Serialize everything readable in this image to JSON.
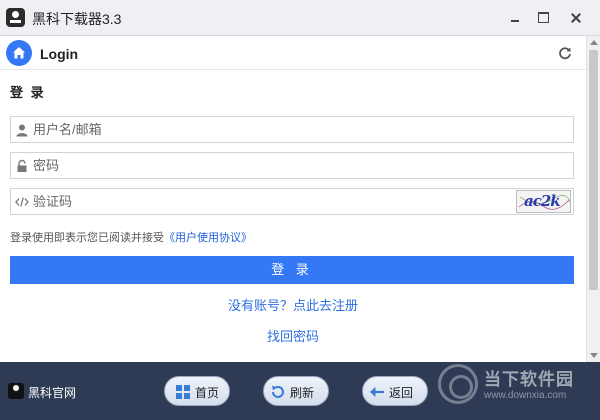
{
  "window": {
    "title": "黑科下载器3.3"
  },
  "header": {
    "title": "Login"
  },
  "form": {
    "section_title": "登 录",
    "username_placeholder": "用户名/邮箱",
    "password_placeholder": "密码",
    "captcha_placeholder": "验证码",
    "captcha_text": "ac2k",
    "agreement_prefix": "登录使用即表示您已阅读并接受",
    "agreement_link": "《用户使用协议》",
    "login_label": "登 录",
    "register_label": "没有账号？点此去注册",
    "recover_label": "找回密码"
  },
  "footer": {
    "site_label": "黑科官网",
    "home_label": "首页",
    "refresh_label": "刷新",
    "back_label": "返回"
  },
  "watermark": {
    "text": "当下软件园",
    "url": "www.downxia.com"
  },
  "colors": {
    "accent": "#3478f6",
    "link": "#2e6fe0",
    "footer_bg": "#2f3a54"
  }
}
